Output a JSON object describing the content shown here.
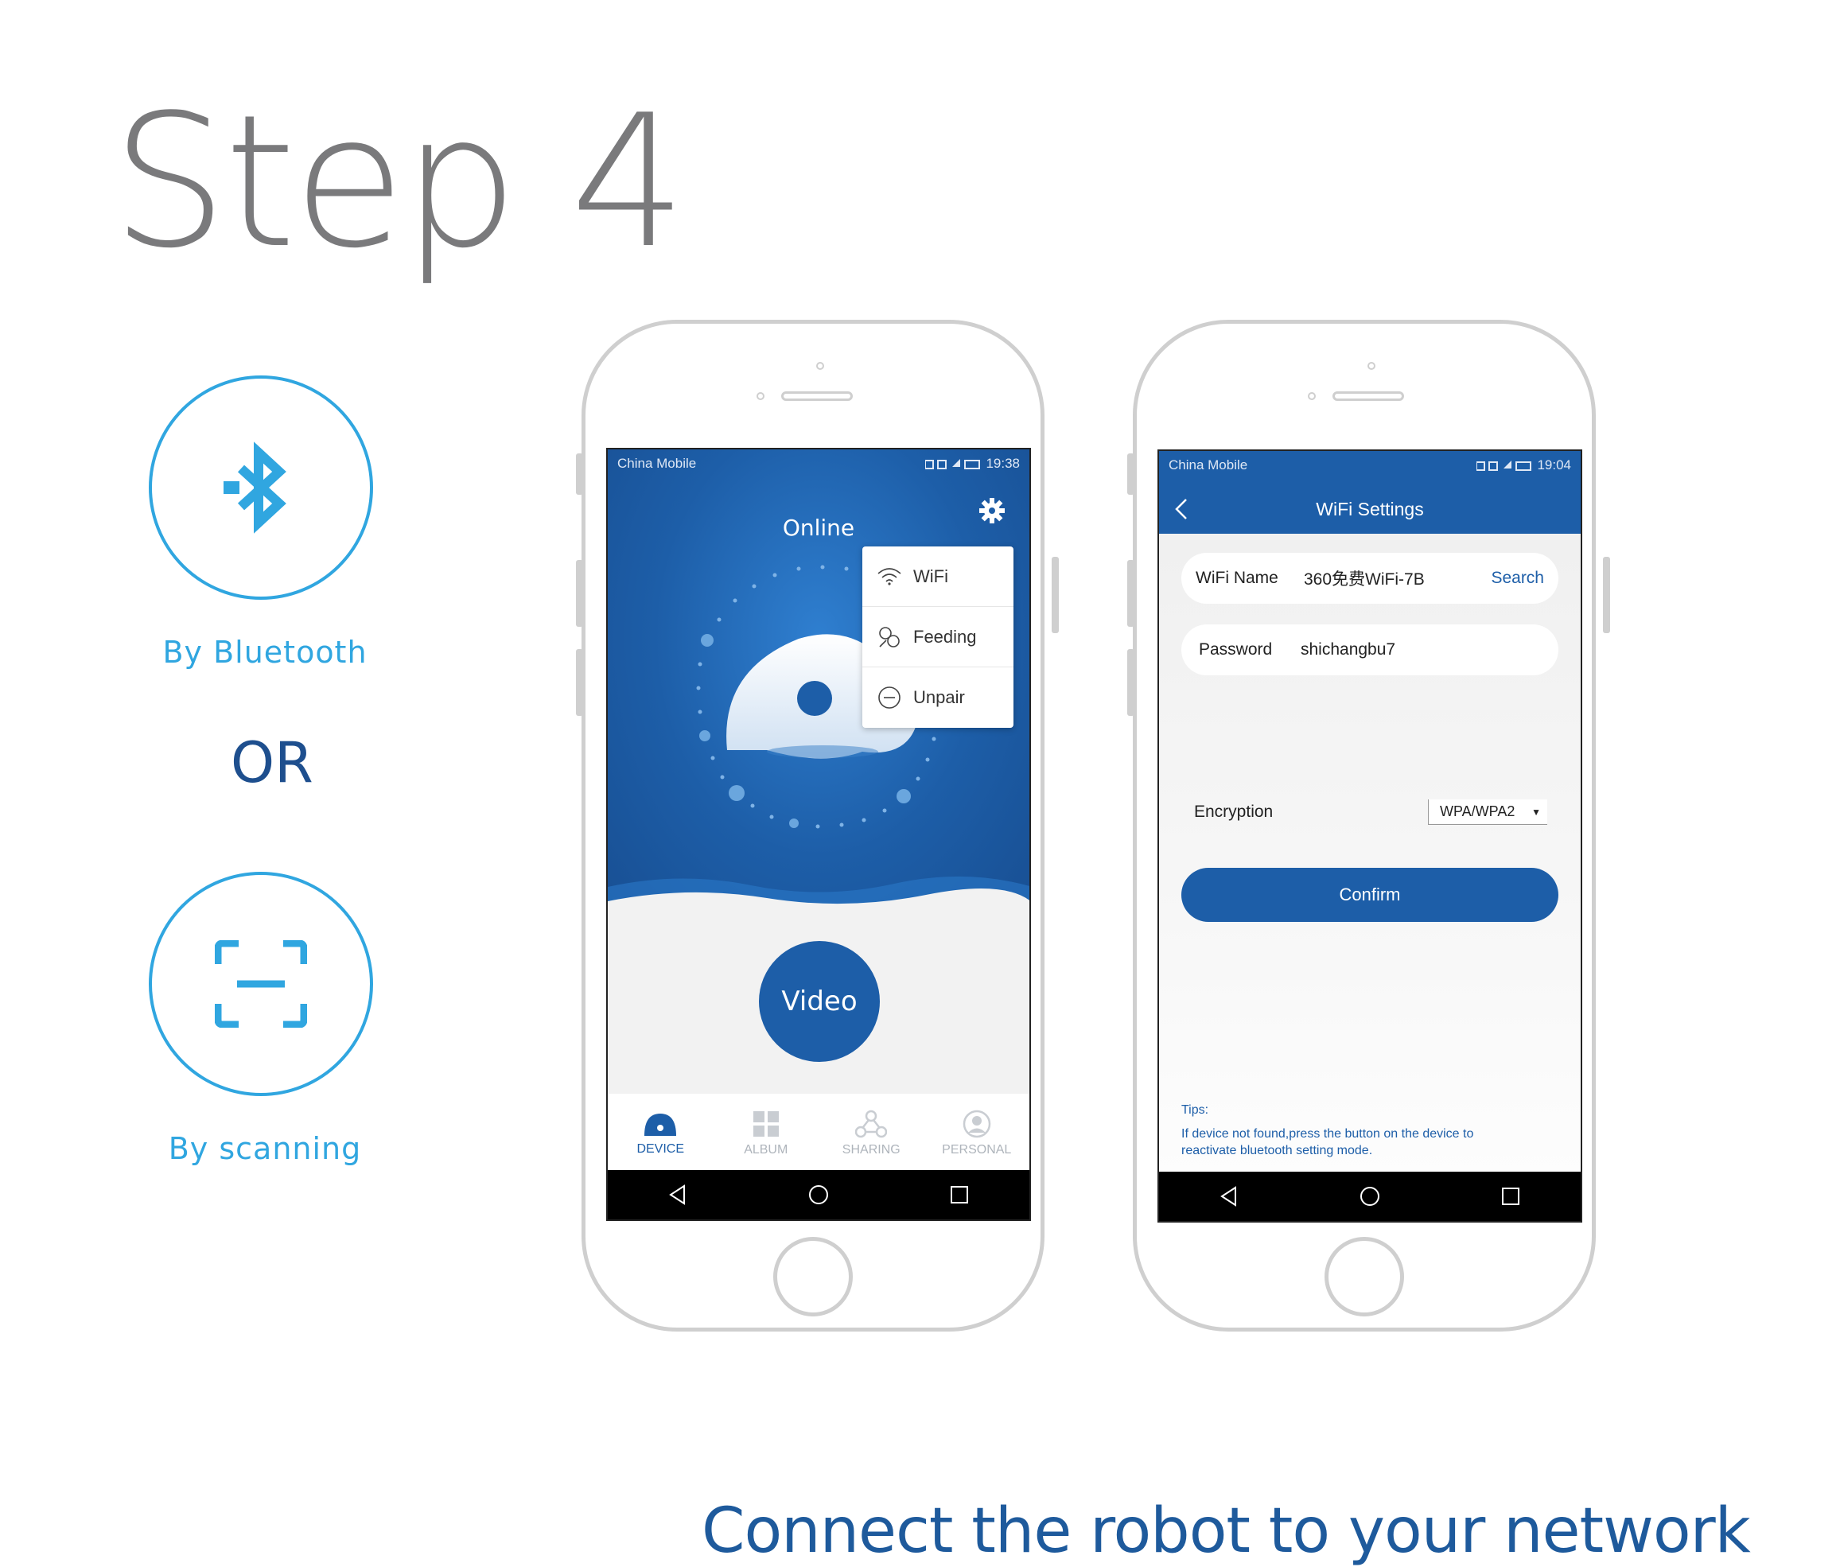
{
  "page": {
    "title": "Step 4",
    "caption": "Connect the robot to your network",
    "option_bluetooth": {
      "label": "By Bluetooth",
      "icon": "bluetooth-icon"
    },
    "or_label": "OR",
    "option_scan": {
      "label": "By scanning",
      "icon": "scan-icon"
    },
    "accent_color": "#30a6e0",
    "brand_color": "#1d5ea8"
  },
  "phone1": {
    "status": {
      "carrier": "China Mobile",
      "time": "19:38"
    },
    "connection_status": "Online",
    "menu": [
      {
        "label": "WiFi",
        "icon": "wifi-icon"
      },
      {
        "label": "Feeding",
        "icon": "feeding-icon"
      },
      {
        "label": "Unpair",
        "icon": "unpair-icon"
      }
    ],
    "video_button": "Video",
    "tabs": [
      {
        "label": "DEVICE",
        "icon": "device-icon",
        "active": true
      },
      {
        "label": "ALBUM",
        "icon": "album-icon",
        "active": false
      },
      {
        "label": "SHARING",
        "icon": "sharing-icon",
        "active": false
      },
      {
        "label": "PERSONAL",
        "icon": "personal-icon",
        "active": false
      }
    ]
  },
  "phone2": {
    "status": {
      "carrier": "China Mobile",
      "time": "19:04"
    },
    "header_title": "WiFi Settings",
    "wifi_name_label": "WiFi Name",
    "wifi_name_value": "360免费WiFi-7B",
    "search_label": "Search",
    "password_label": "Password",
    "password_value": "shichangbu7",
    "encryption_label": "Encryption",
    "encryption_value": "WPA/WPA2",
    "confirm_label": "Confirm",
    "tips_title": "Tips:",
    "tips_line1": "If device not found,press the button on the device to",
    "tips_line2": "reactivate bluetooth setting mode."
  }
}
